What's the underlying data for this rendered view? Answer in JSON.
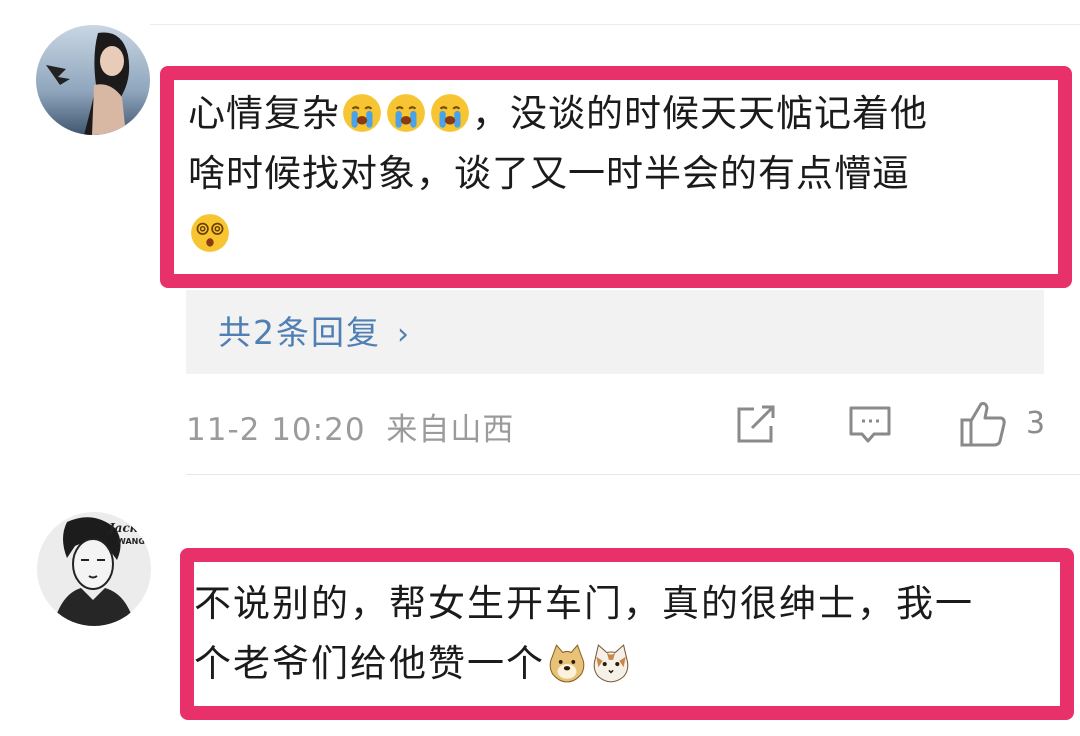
{
  "comment1": {
    "line1": "心情复杂",
    "line1_after": "，没谈的时候天天惦记着他",
    "line2": "啥时候找对象，谈了又一时半会的有点懵逼",
    "emoji_cry": "loudly-crying-face-icon",
    "emoji_dizzy": "dizzy-face-icon",
    "replies": "共2条回复",
    "time": "11-2 10:20",
    "source": "来自山西",
    "like_count": "3"
  },
  "comment2": {
    "line1": "不说别的，帮女生开车门，真的很绅士，我一",
    "line2": "个老爷们给他赞一个",
    "emoji_doge": "doge-icon",
    "emoji_cat": "cat-face-icon"
  },
  "colors": {
    "highlight": "#e8316b",
    "link": "#4f7fb3",
    "meta": "#9b9b9b"
  }
}
